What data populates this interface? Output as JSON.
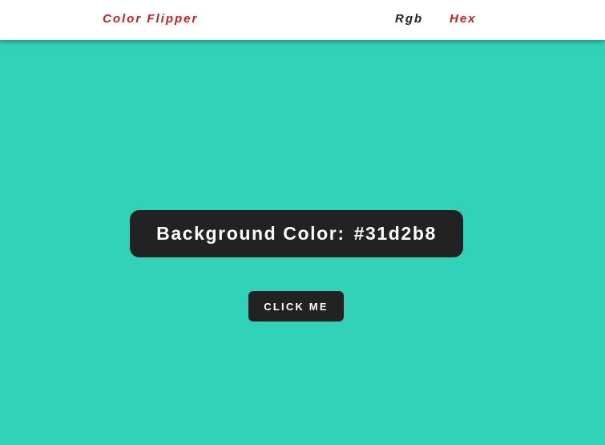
{
  "nav": {
    "brand": "Color Flipper",
    "links": [
      {
        "label": "Rgb"
      },
      {
        "label": "Hex"
      }
    ]
  },
  "banner": {
    "label": "Background Color:",
    "value": "#31d2b8"
  },
  "button": {
    "label": "click me"
  },
  "colors": {
    "background": "#31d2b8",
    "brand": "#c4201f",
    "nav_inactive": "#222222",
    "nav_active": "#c4201f",
    "panel": "#222222",
    "panel_text": "#ffffff"
  }
}
